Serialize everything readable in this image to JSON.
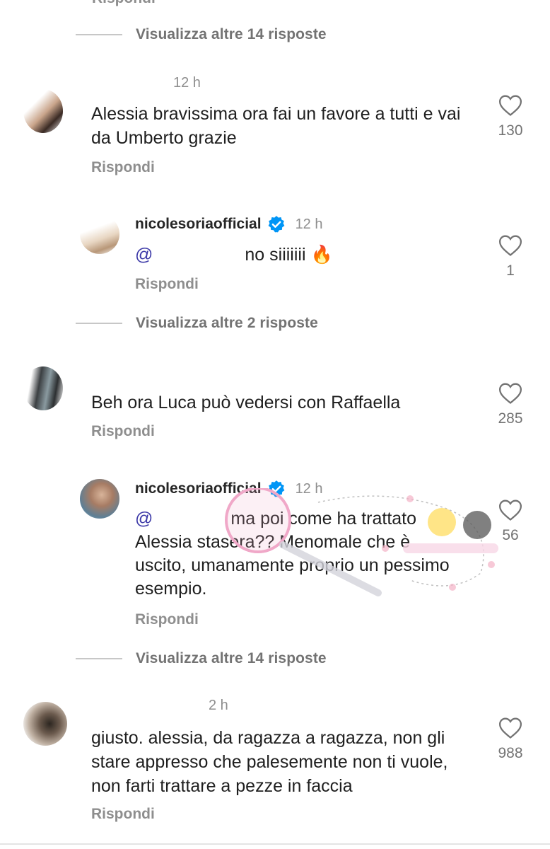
{
  "colors": {
    "mention": "#3d3aa8",
    "secondary": "#8e8e8e",
    "verified": "#0095f6",
    "fire": "#ff7a00"
  },
  "view_more": [
    {
      "label": "Visualizza altre 14 risposte"
    },
    {
      "label": "Visualizza altre 2 risposte"
    },
    {
      "label": "Visualizza altre 14 risposte"
    }
  ],
  "top_reply_cut": "Rispondi",
  "comments": [
    {
      "time": "12 h",
      "text": "Alessia bravissima ora fai un favore a tutti e vai da Umberto grazie",
      "reply": "Rispondi",
      "likes": "130"
    },
    {
      "user": "nicolesoriaofficial",
      "time": "12 h",
      "mention": "@",
      "text": "no siiiiiii",
      "emoji": "🔥",
      "reply": "Rispondi",
      "likes": "1"
    },
    {
      "time": "",
      "text": "Beh ora Luca può vedersi con Raffaella",
      "reply": "Rispondi",
      "likes": "285"
    },
    {
      "user": "nicolesoriaofficial",
      "time": "12 h",
      "mention": "@",
      "text": "ma poi come ha trattato Alessia stasera?? Menomale che è uscito, umanamente proprio un pessimo esempio.",
      "reply": "Rispondi",
      "likes": "56"
    },
    {
      "time": "2 h",
      "text": "giusto. alessia, da ragazza a ragazza, non gli stare appresso che palesemente non ti vuole, non farti trattare a pezze in faccia",
      "reply": "Rispondi",
      "likes": "988"
    }
  ]
}
